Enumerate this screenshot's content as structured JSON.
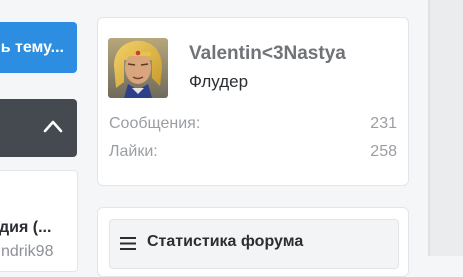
{
  "sidebar_left": {
    "create_thread_label": "ь тему...",
    "collapse_icon": "chevron-up-icon",
    "thread_title": "дия (...",
    "thread_author": "ndrik98"
  },
  "profile": {
    "username": "Valentin<3Nastya",
    "user_title": "Флудер",
    "stats": [
      {
        "label": "Сообщения:",
        "value": "231"
      },
      {
        "label": "Лайки:",
        "value": "258"
      }
    ]
  },
  "forum_stats": {
    "title": "Статистика форума",
    "icon": "menu-icon"
  },
  "colors": {
    "accent": "#2d8de0",
    "dark_button": "#454a50",
    "background": "#f5f6f7"
  }
}
